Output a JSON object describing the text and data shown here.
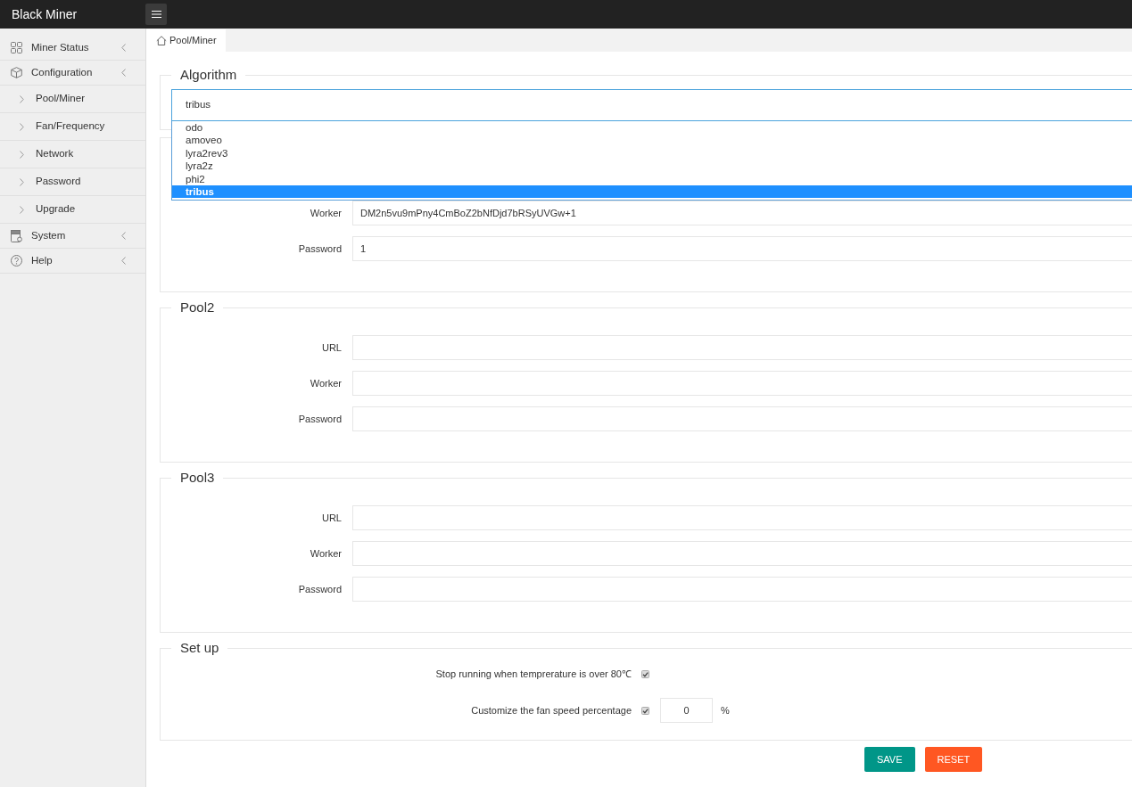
{
  "topbar": {
    "title": "Black Miner"
  },
  "sidebar": {
    "items": [
      {
        "label": "Miner Status"
      },
      {
        "label": "Configuration",
        "children": [
          {
            "label": "Pool/Miner"
          },
          {
            "label": "Fan/Frequency"
          },
          {
            "label": "Network"
          },
          {
            "label": "Password"
          },
          {
            "label": "Upgrade"
          }
        ]
      },
      {
        "label": "System"
      },
      {
        "label": "Help"
      }
    ]
  },
  "tabs": [
    {
      "label": "Pool/Miner",
      "selected": true
    }
  ],
  "algorithm": {
    "title": "Algorithm",
    "value": "tribus",
    "expanded": true,
    "options": [
      {
        "label": "odo",
        "selected": false
      },
      {
        "label": "amoveo",
        "selected": false
      },
      {
        "label": "lyra2rev3",
        "selected": false
      },
      {
        "label": "lyra2z",
        "selected": false
      },
      {
        "label": "phi2",
        "selected": false
      },
      {
        "label": "tribus",
        "selected": true
      }
    ]
  },
  "pools": [
    {
      "fields": [
        {
          "label": "Worker",
          "value": "DM2n5vu9mPny4CmBoZ2bNfDjd7bRSyUVGw+1"
        },
        {
          "label": "Password",
          "value": "1"
        }
      ]
    },
    {
      "title": "Pool2",
      "fields": [
        {
          "label": "URL"
        },
        {
          "label": "Worker"
        },
        {
          "label": "Password"
        }
      ]
    },
    {
      "title": "Pool3",
      "fields": [
        {
          "label": "URL"
        },
        {
          "label": "Worker"
        },
        {
          "label": "Password"
        }
      ]
    }
  ],
  "setup": {
    "title": "Set up",
    "items": [
      {
        "label": "Stop running when temprerature is over 80℃",
        "checked": true
      },
      {
        "label": "Customize the fan speed percentage",
        "checked": true,
        "value": "0",
        "unit": "%"
      }
    ]
  },
  "buttons": [
    {
      "label": "SAVE",
      "kind": "submit"
    },
    {
      "label": "RESET",
      "kind": "reset"
    }
  ]
}
